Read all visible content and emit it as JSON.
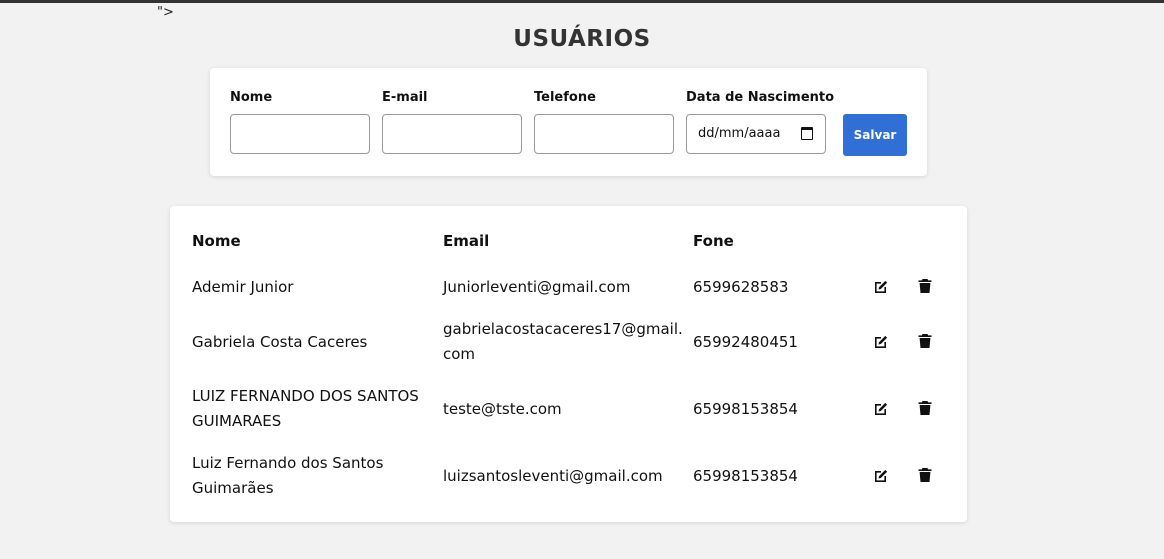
{
  "stray_text": "\">",
  "page": {
    "title": "USUÁRIOS"
  },
  "form": {
    "name_label": "Nome",
    "email_label": "E-mail",
    "phone_label": "Telefone",
    "birthdate_label": "Data de Nascimento",
    "birthdate_placeholder": "dd/mm/aaaa",
    "save_label": "Salvar"
  },
  "table": {
    "headers": {
      "name": "Nome",
      "email": "Email",
      "phone": "Fone"
    },
    "rows": [
      {
        "name": "Ademir Junior",
        "email": "Juniorleventi@gmail.com",
        "phone": "6599628583"
      },
      {
        "name": "Gabriela Costa Caceres",
        "email": "gabrielacostacaceres17@gmail.com",
        "phone": "65992480451"
      },
      {
        "name": "LUIZ FERNANDO DOS SANTOS GUIMARAES",
        "email": "teste@tste.com",
        "phone": "65998153854"
      },
      {
        "name": "Luiz Fernando dos Santos Guimarães",
        "email": "luizsantosleventi@gmail.com",
        "phone": "65998153854"
      }
    ]
  },
  "colors": {
    "primary": "#2f6fd6",
    "background": "#f2f2f2"
  },
  "icons": {
    "edit": "edit-icon",
    "delete": "trash-icon"
  }
}
